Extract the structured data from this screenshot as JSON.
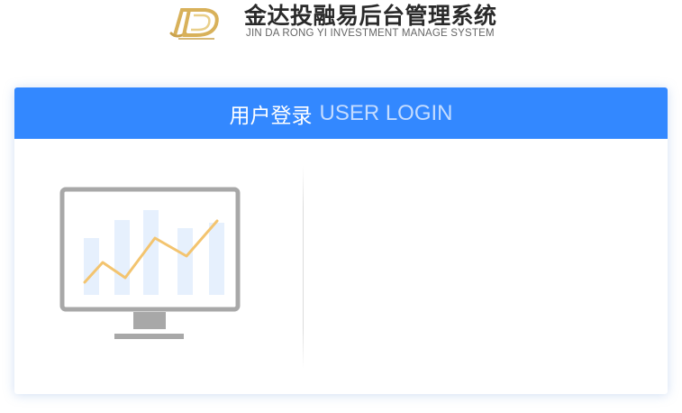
{
  "header": {
    "title_cn": "金达投融易后台管理系统",
    "title_en": "JIN DA RONG YI INVESTMENT MANAGE SYSTEM",
    "logo_icon": "jd-logo-icon"
  },
  "login": {
    "header_cn": "用户登录",
    "header_en": "USER LOGIN",
    "illustration_icon": "monitor-chart-icon"
  },
  "colors": {
    "accent": "#3388ff",
    "header_en_text": "#c4dcff",
    "logo_gold": "#d8b15a",
    "chart_bars": "#e6f0fd",
    "chart_line": "#f3c46f",
    "monitor_frame": "#a8a8a8"
  }
}
